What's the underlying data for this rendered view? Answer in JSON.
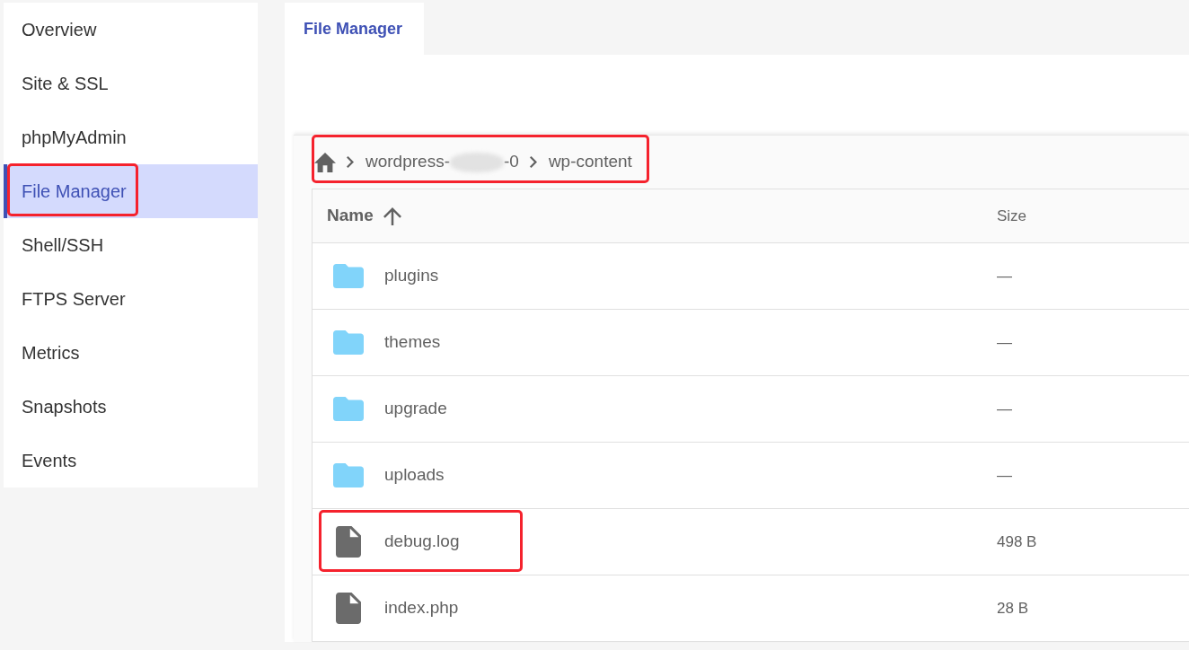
{
  "sidebar": {
    "items": [
      {
        "label": "Overview",
        "selected": false,
        "annotated": false
      },
      {
        "label": "Site & SSL",
        "selected": false,
        "annotated": false
      },
      {
        "label": "phpMyAdmin",
        "selected": false,
        "annotated": false
      },
      {
        "label": "File Manager",
        "selected": true,
        "annotated": true
      },
      {
        "label": "Shell/SSH",
        "selected": false,
        "annotated": false
      },
      {
        "label": "FTPS Server",
        "selected": false,
        "annotated": false
      },
      {
        "label": "Metrics",
        "selected": false,
        "annotated": false
      },
      {
        "label": "Snapshots",
        "selected": false,
        "annotated": false
      },
      {
        "label": "Events",
        "selected": false,
        "annotated": false
      }
    ]
  },
  "tabs": [
    {
      "label": "File Manager",
      "selected": true
    }
  ],
  "breadcrumb": {
    "annotated": true,
    "crumbs": [
      {
        "kind": "home"
      },
      {
        "kind": "path",
        "parts": [
          "wordpress-",
          "-0"
        ],
        "redacted": true
      },
      {
        "kind": "path",
        "parts": [
          "wp-content"
        ],
        "redacted": false
      }
    ]
  },
  "table": {
    "columns": [
      {
        "label": "Name",
        "sorted": true,
        "descending": false
      },
      {
        "label": "Size",
        "sorted": false
      }
    ],
    "rows": [
      {
        "kind": "folder",
        "name": "plugins",
        "size": "—",
        "annotated": false
      },
      {
        "kind": "folder",
        "name": "themes",
        "size": "—",
        "annotated": false
      },
      {
        "kind": "folder",
        "name": "upgrade",
        "size": "—",
        "annotated": false
      },
      {
        "kind": "folder",
        "name": "uploads",
        "size": "—",
        "annotated": false
      },
      {
        "kind": "file",
        "name": "debug.log",
        "size": "498 B",
        "annotated": true
      },
      {
        "kind": "file",
        "name": "index.php",
        "size": "28 B",
        "annotated": false
      }
    ]
  }
}
